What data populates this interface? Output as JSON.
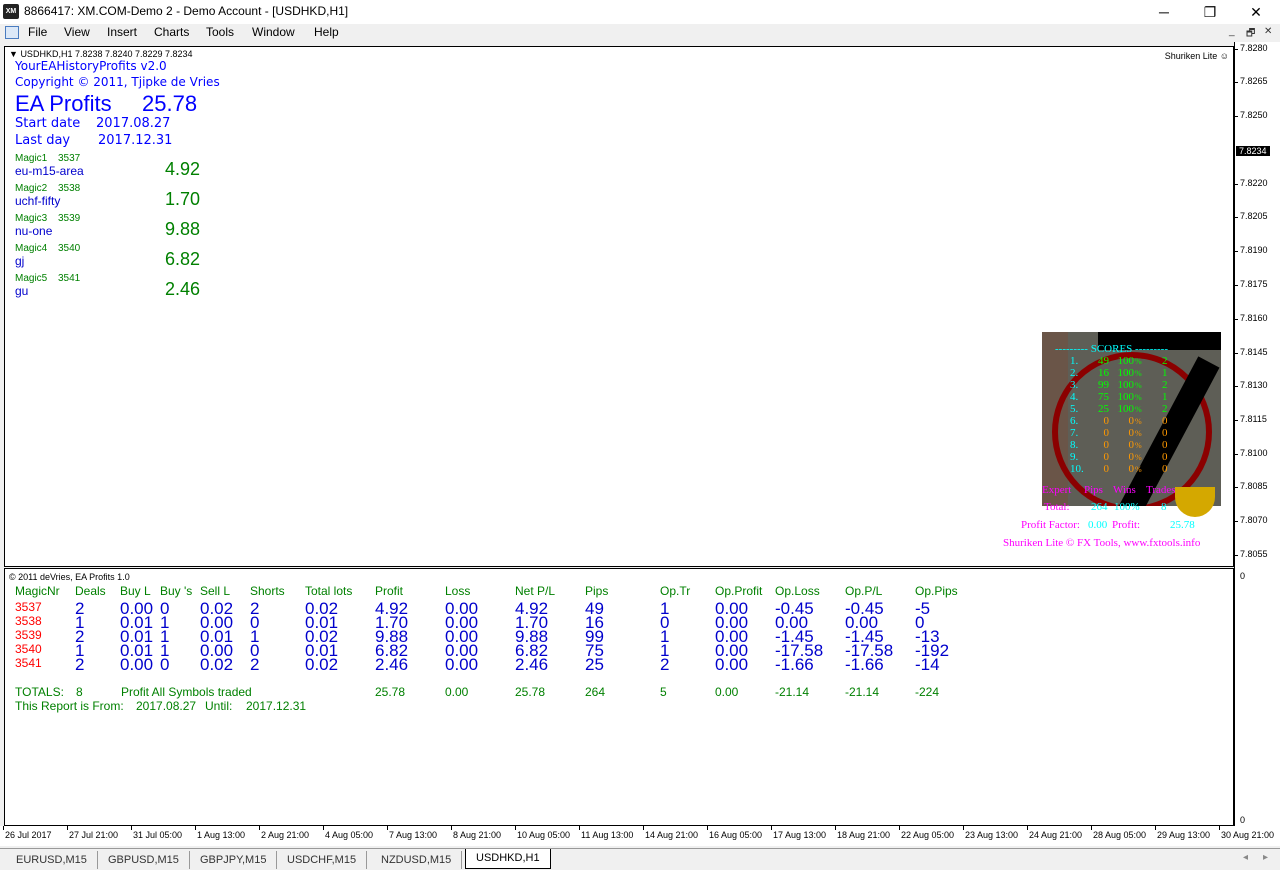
{
  "window": {
    "title": "8866417: XM.COM-Demo 2 - Demo Account - [USDHKD,H1]",
    "logo": "XM",
    "minimize": "─",
    "maximize": "❐",
    "close": "✕"
  },
  "menu": [
    "File",
    "View",
    "Insert",
    "Charts",
    "Tools",
    "Window",
    "Help"
  ],
  "mdi_controls": [
    "_",
    "🗗",
    "✕"
  ],
  "chart": {
    "header": "USDHKD,H1  7.8238 7.8240 7.8229 7.8234",
    "shuriken_label": "Shuriken Lite",
    "ea_name": "YourEAHistoryProfits v2.0",
    "copyright": "Copyright © 2011, Tjipke de Vries",
    "ea_profits_label": "EA Profits",
    "ea_profits_value": "25.78",
    "start_label": "Start date",
    "start_value": "2017.08.27",
    "last_label": "Last day",
    "last_value": "2017.12.31",
    "magics": [
      {
        "label": "Magic1",
        "nr": "3537",
        "name": "eu-m15-area",
        "profit": "4.92"
      },
      {
        "label": "Magic2",
        "nr": "3538",
        "name": "uchf-fifty",
        "profit": "1.70"
      },
      {
        "label": "Magic3",
        "nr": "3539",
        "name": "nu-one",
        "profit": "9.88"
      },
      {
        "label": "Magic4",
        "nr": "3540",
        "name": "gj",
        "profit": "6.82"
      },
      {
        "label": "Magic5",
        "nr": "3541",
        "name": "gu",
        "profit": "2.46"
      }
    ],
    "scores": {
      "title": "--------- SCORES ---------",
      "rows": [
        [
          "1.",
          "49",
          "100",
          "%",
          "2"
        ],
        [
          "2.",
          "16",
          "100",
          "%",
          "1"
        ],
        [
          "3.",
          "99",
          "100",
          "%",
          "2"
        ],
        [
          "4.",
          "75",
          "100",
          "%",
          "1"
        ],
        [
          "5.",
          "25",
          "100",
          "%",
          "2"
        ],
        [
          "6.",
          "0",
          "0",
          "%",
          "0"
        ],
        [
          "7.",
          "0",
          "0",
          "%",
          "0"
        ],
        [
          "8.",
          "0",
          "0",
          "%",
          "0"
        ],
        [
          "9.",
          "0",
          "0",
          "%",
          "0"
        ],
        [
          "10.",
          "0",
          "0",
          "%",
          "0"
        ]
      ],
      "headers": [
        "Expert",
        "Pips",
        "Wins",
        "Trades"
      ],
      "total_label": "Total:",
      "total_pips": "264",
      "total_wins": "100%",
      "total_trades": "8",
      "pf_label": "Profit Factor:",
      "pf_value": "0.00",
      "profit_label": "Profit:",
      "profit_value": "25.78",
      "footer": "Shuriken Lite © FX Tools, www.fxtools.info"
    }
  },
  "price_axis": {
    "labels": [
      "7.8280",
      "7.8265",
      "7.8250",
      "7.8220",
      "7.8205",
      "7.8190",
      "7.8175",
      "7.8160",
      "7.8145",
      "7.8130",
      "7.8115",
      "7.8100",
      "7.8085",
      "7.8070",
      "7.8055"
    ],
    "current": "7.8234",
    "sub_top": "0",
    "sub_bottom": "0"
  },
  "subwindow": {
    "title": "© 2011 deVries, EA Profits 1.0",
    "columns": [
      "MagicNr",
      "Deals",
      "Buy L",
      "Buy 's",
      "Sell L",
      "Shorts",
      "Total lots",
      "Profit",
      "Loss",
      "Net P/L",
      "Pips",
      "Op.Tr",
      "Op.Profit",
      "Op.Loss",
      "Op.P/L",
      "Op.Pips"
    ],
    "rows": [
      [
        "3537",
        "2",
        "0.00",
        "0",
        "0.02",
        "2",
        "0.02",
        "4.92",
        "0.00",
        "4.92",
        "49",
        "1",
        "0.00",
        "-0.45",
        "-0.45",
        "-5"
      ],
      [
        "3538",
        "1",
        "0.01",
        "1",
        "0.00",
        "0",
        "0.01",
        "1.70",
        "0.00",
        "1.70",
        "16",
        "0",
        "0.00",
        "0.00",
        "0.00",
        "0"
      ],
      [
        "3539",
        "2",
        "0.01",
        "1",
        "0.01",
        "1",
        "0.02",
        "9.88",
        "0.00",
        "9.88",
        "99",
        "1",
        "0.00",
        "-1.45",
        "-1.45",
        "-13"
      ],
      [
        "3540",
        "1",
        "0.01",
        "1",
        "0.00",
        "0",
        "0.01",
        "6.82",
        "0.00",
        "6.82",
        "75",
        "1",
        "0.00",
        "-17.58",
        "-17.58",
        "-192"
      ],
      [
        "3541",
        "2",
        "0.00",
        "0",
        "0.02",
        "2",
        "0.02",
        "2.46",
        "0.00",
        "2.46",
        "25",
        "2",
        "0.00",
        "-1.66",
        "-1.66",
        "-14"
      ]
    ],
    "totals_label": "TOTALS:",
    "totals_deals": "8",
    "totals_note": "Profit  All  Symbols  traded",
    "totals": [
      "25.78",
      "0.00",
      "25.78",
      "264",
      "5",
      "0.00",
      "-21.14",
      "-21.14",
      "-224"
    ],
    "report_label": "This Report is From:",
    "report_from": "2017.08.27",
    "report_until_label": "Until:",
    "report_until": "2017.12.31"
  },
  "time_axis": [
    "26 Jul 2017",
    "27 Jul 21:00",
    "31 Jul 05:00",
    "1 Aug 13:00",
    "2 Aug 21:00",
    "4 Aug 05:00",
    "7 Aug 13:00",
    "8 Aug 21:00",
    "10 Aug 05:00",
    "11 Aug 13:00",
    "14 Aug 21:00",
    "16 Aug 05:00",
    "17 Aug 13:00",
    "18 Aug 21:00",
    "22 Aug 05:00",
    "23 Aug 13:00",
    "24 Aug 21:00",
    "28 Aug 05:00",
    "29 Aug 13:00",
    "30 Aug 21:00"
  ],
  "tabs": [
    {
      "label": "EURUSD,M15"
    },
    {
      "label": "GBPUSD,M15"
    },
    {
      "label": "GBPJPY,M15"
    },
    {
      "label": "USDCHF,M15"
    },
    {
      "label": "NZDUSD,M15"
    },
    {
      "label": "USDHKD,H1",
      "active": true
    }
  ],
  "tab_scroll": [
    "◂",
    "▸"
  ]
}
